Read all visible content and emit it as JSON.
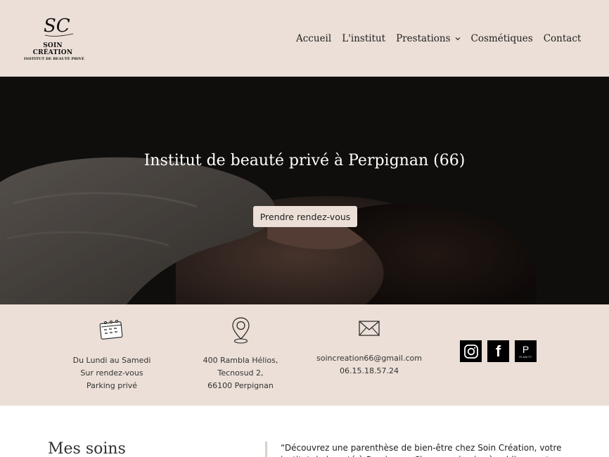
{
  "brand": {
    "monogram": "SC",
    "name": "SOIN CRÉATION",
    "tagline": "INSTITUT DE BEAUTÉ PRIVÉ"
  },
  "nav": {
    "items": [
      {
        "label": "Accueil"
      },
      {
        "label": "L'institut"
      },
      {
        "label": "Prestations"
      },
      {
        "label": "Cosmétiques"
      },
      {
        "label": "Contact"
      }
    ]
  },
  "hero": {
    "title": "Institut de beauté privé à Perpignan (66)",
    "cta": "Prendre rendez-vous"
  },
  "info": {
    "hours": {
      "icon": "calendar-icon",
      "lines": [
        "Du Lundi au Samedi",
        "Sur rendez-vous",
        "Parking privé"
      ]
    },
    "address": {
      "icon": "location-pin-icon",
      "lines": [
        "400 Rambla Hélios,",
        "Tecnosud 2,",
        "66100 Perpignan"
      ]
    },
    "contact": {
      "icon": "envelope-icon",
      "lines": [
        "soincreation66@gmail.com",
        "06.15.18.57.24"
      ]
    },
    "socials": [
      {
        "icon": "instagram-icon"
      },
      {
        "icon": "facebook-icon",
        "glyph": "f"
      },
      {
        "icon": "planity-icon",
        "glyph": "P",
        "caption": "PLANITY"
      }
    ]
  },
  "main": {
    "soins_title": "Mes soins",
    "quote": "“Découvrez une parenthèse de bien-être chez Soin Création, votre institut de beauté à Perpignan. Chaque soin vise à sublimer votre beauté"
  },
  "colors": {
    "beige": "#ebdfd7",
    "hero_dark": "#141211",
    "text": "#222222"
  }
}
